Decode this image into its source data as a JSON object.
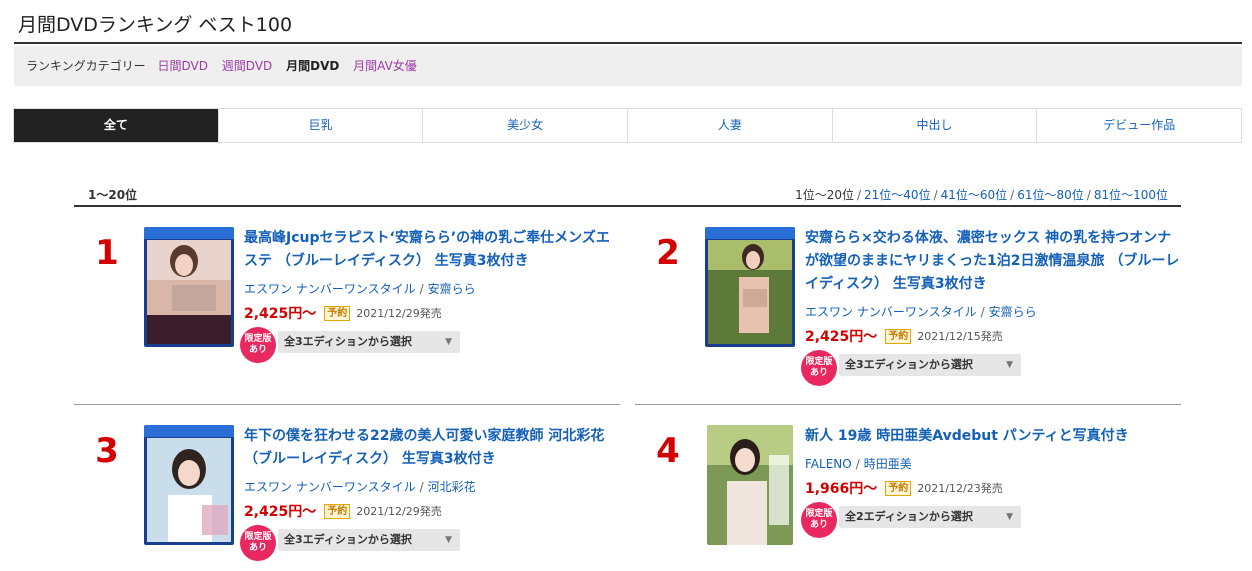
{
  "page": {
    "title": "月間DVDランキング ベスト100"
  },
  "category": {
    "label": "ランキングカテゴリー",
    "items": [
      {
        "label": "日間DVD",
        "active": false
      },
      {
        "label": "週間DVD",
        "active": false
      },
      {
        "label": "月間DVD",
        "active": true
      },
      {
        "label": "月間AV女優",
        "active": false
      }
    ]
  },
  "genre_tabs": [
    {
      "label": "全て",
      "active": true
    },
    {
      "label": "巨乳",
      "active": false
    },
    {
      "label": "美少女",
      "active": false
    },
    {
      "label": "人妻",
      "active": false
    },
    {
      "label": "中出し",
      "active": false
    },
    {
      "label": "デビュー作品",
      "active": false
    }
  ],
  "range": {
    "current_heading": "1〜20位",
    "current": "1位〜20位",
    "links": [
      "21位〜40位",
      "41位〜60位",
      "61位〜80位",
      "81位〜100位"
    ]
  },
  "items": [
    {
      "rank": "1",
      "title": "最高峰Jcupセラピスト‘安齋らら’の神の乳ご奉仕メンズエステ （ブルーレイディスク） 生写真3枚付き",
      "maker": "エスワン ナンバーワンスタイル",
      "actress": "安齋らら",
      "price": "2,425円〜",
      "preorder_badge": "予約",
      "release": "2021/12/29発売",
      "limited_badge": "限定版あり",
      "edition_select": "全3エディションから選択",
      "cover_type": "bluray"
    },
    {
      "rank": "2",
      "title": "安齋らら×交わる体液、濃密セックス 神の乳を持つオンナが欲望のままにヤリまくった1泊2日激情温泉旅 （ブルーレイディスク） 生写真3枚付き",
      "maker": "エスワン ナンバーワンスタイル",
      "actress": "安齋らら",
      "price": "2,425円〜",
      "preorder_badge": "予約",
      "release": "2021/12/15発売",
      "limited_badge": "限定版あり",
      "edition_select": "全3エディションから選択",
      "cover_type": "bluray"
    },
    {
      "rank": "3",
      "title": "年下の僕を狂わせる22歳の美人可愛い家庭教師 河北彩花 （ブルーレイディスク） 生写真3枚付き",
      "maker": "エスワン ナンバーワンスタイル",
      "actress": "河北彩花",
      "price": "2,425円〜",
      "preorder_badge": "予約",
      "release": "2021/12/29発売",
      "limited_badge": "限定版あり",
      "edition_select": "全3エディションから選択",
      "cover_type": "bluray"
    },
    {
      "rank": "4",
      "title": "新人 19歳 時田亜美Avdebut パンティと写真付き",
      "maker": "FALENO",
      "actress": "時田亜美",
      "price": "1,966円〜",
      "preorder_badge": "予約",
      "release": "2021/12/23発売",
      "limited_badge": "限定版あり",
      "edition_select": "全2エディションから選択",
      "cover_type": "dvd"
    }
  ],
  "colors": {
    "link": "#1460b8",
    "price": "#d20000",
    "category_link": "#a03aa8",
    "badge": "#e8285e",
    "active_tab": "#222222"
  }
}
